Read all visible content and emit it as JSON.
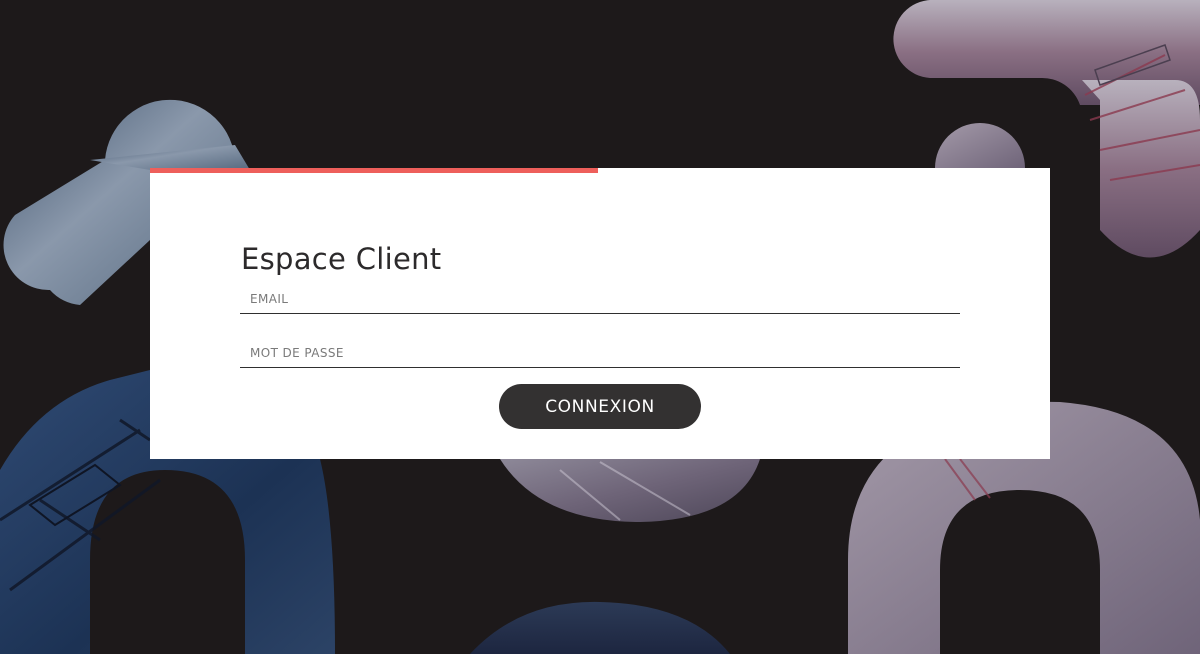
{
  "login": {
    "title": "Espace Client",
    "email_placeholder": "EMAIL",
    "password_placeholder": "MOT DE PASSE",
    "submit_label": "CONNEXION"
  },
  "colors": {
    "background": "#1d191a",
    "card": "#ffffff",
    "accent": "#ee5f5b",
    "button": "#333131"
  }
}
